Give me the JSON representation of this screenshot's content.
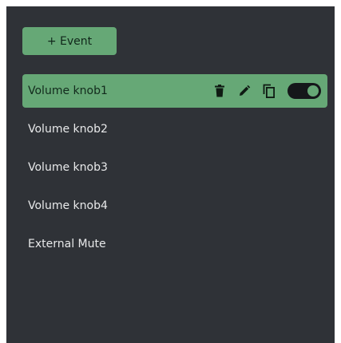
{
  "toolbar": {
    "add_event_label": "+ Event"
  },
  "events": [
    {
      "label": "Volume knob1",
      "selected": true,
      "enabled": true
    },
    {
      "label": "Volume knob2",
      "selected": false
    },
    {
      "label": "Volume knob3",
      "selected": false
    },
    {
      "label": "Volume knob4",
      "selected": false
    },
    {
      "label": "External Mute",
      "selected": false
    }
  ],
  "row_actions": {
    "icons": [
      "delete-icon",
      "edit-icon",
      "copy-icon"
    ],
    "toggle": "enable-toggle"
  },
  "colors": {
    "panel_bg": "#2f3237",
    "accent": "#66a876",
    "text": "#e8e9ea",
    "toggle_track": "#15171a"
  }
}
